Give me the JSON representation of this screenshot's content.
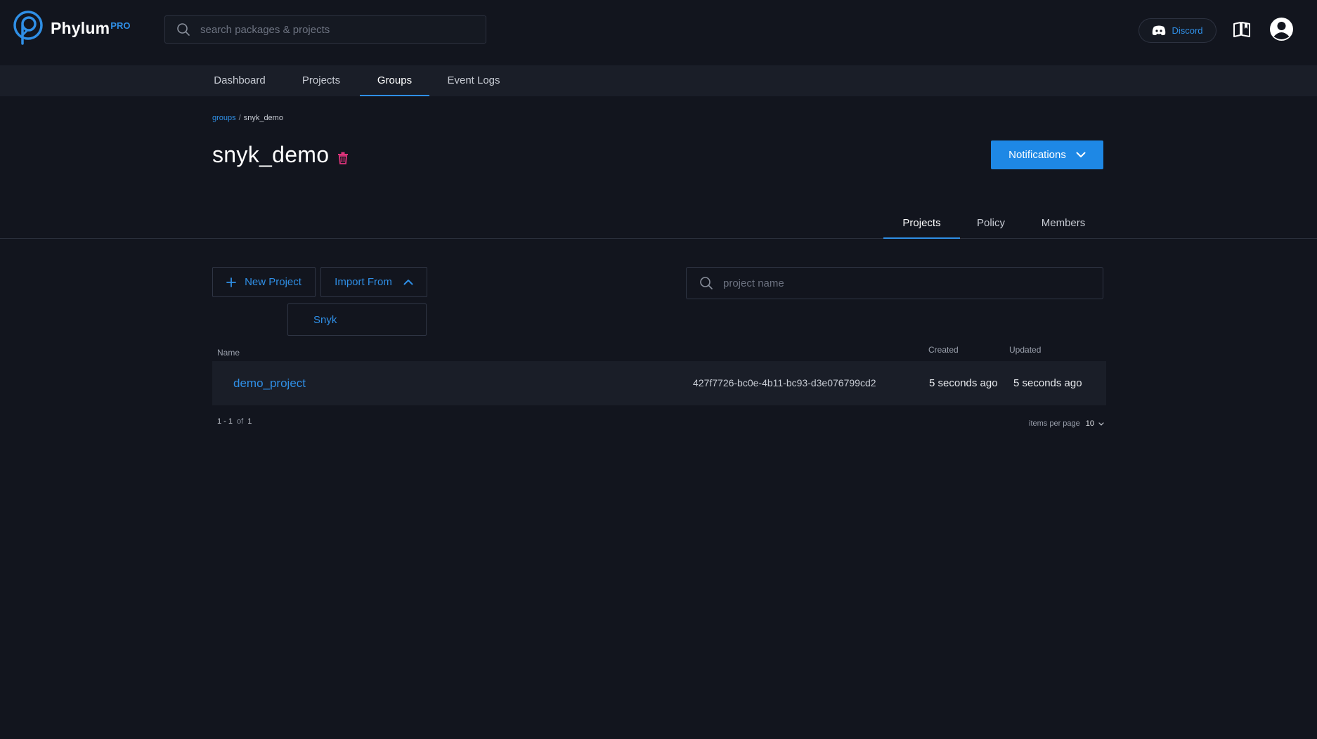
{
  "brand": {
    "name": "Phylum",
    "badge": "PRO"
  },
  "search": {
    "placeholder": "search packages & projects"
  },
  "header": {
    "discord_label": "Discord"
  },
  "nav": {
    "items": [
      {
        "label": "Dashboard"
      },
      {
        "label": "Projects"
      },
      {
        "label": "Groups",
        "active": true
      },
      {
        "label": "Event Logs"
      }
    ]
  },
  "breadcrumb": {
    "root": "groups",
    "separator": "/",
    "current": "snyk_demo"
  },
  "page": {
    "title": "snyk_demo",
    "notifications_label": "Notifications"
  },
  "subtabs": [
    {
      "label": "Projects",
      "active": true
    },
    {
      "label": "Policy"
    },
    {
      "label": "Members"
    }
  ],
  "actions": {
    "new_project": "New Project",
    "import_from": "Import From",
    "import_options": [
      "Snyk"
    ]
  },
  "project_search": {
    "placeholder": "project name"
  },
  "table": {
    "headers": {
      "name": "Name",
      "created": "Created",
      "updated": "Updated"
    },
    "rows": [
      {
        "name": "demo_project",
        "id": "427f7726-bc0e-4b11-bc93-d3e076799cd2",
        "created": "5 seconds ago",
        "updated": "5 seconds ago"
      }
    ]
  },
  "pagination": {
    "range": "1 - 1",
    "of_label": "of",
    "total": "1",
    "per_page_label": "items per page",
    "per_page_value": "10"
  },
  "colors": {
    "background": "#12151e",
    "navbar": "#1a1e28",
    "accent": "#2f8fe6",
    "primary_button": "#1e88e5",
    "danger": "#e0347c"
  }
}
